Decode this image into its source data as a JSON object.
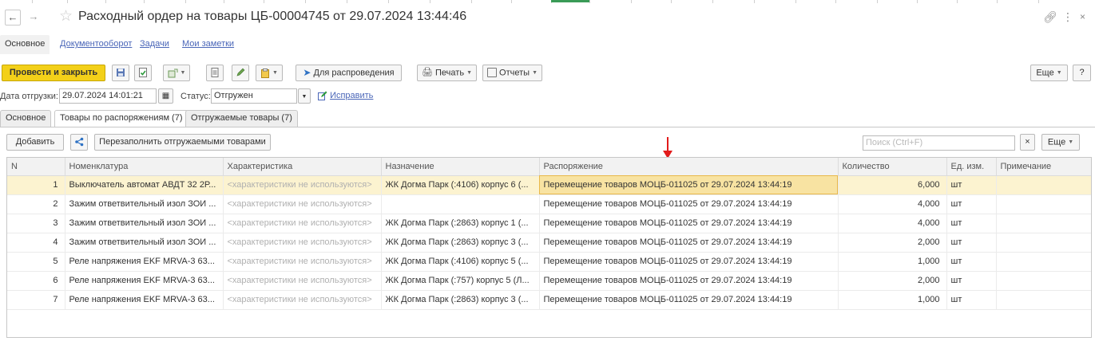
{
  "window": {
    "title": "Расходный ордер на товары ЦБ-00004745 от 29.07.2024 13:44:46"
  },
  "link_tabs": [
    "Основное",
    "Документооборот",
    "Задачи",
    "Мои заметки"
  ],
  "toolbar": {
    "post_close": "Провести и закрыть",
    "for_distribution": "Для распроведения",
    "print": "Печать",
    "reports": "Отчеты",
    "more": "Еще",
    "help": "?"
  },
  "header": {
    "ship_date_label": "Дата отгрузки:",
    "ship_date_value": "29.07.2024 14:01:21",
    "status_label": "Статус:",
    "status_value": "Отгружен",
    "fix_link": "Исправить"
  },
  "tabs": [
    "Основное",
    "Товары по распоряжениям (7)",
    "Отгружаемые товары (7)"
  ],
  "table_toolbar": {
    "add": "Добавить",
    "refill": "Перезаполнить отгружаемыми товарами",
    "search_placeholder": "Поиск (Ctrl+F)",
    "clear": "×",
    "more": "Еще"
  },
  "table": {
    "columns": [
      "N",
      "Номенклатура",
      "Характеристика",
      "Назначение",
      "Распоряжение",
      "Количество",
      "Ед. изм.",
      "Примечание"
    ],
    "rows": [
      {
        "n": "1",
        "item": "Выключатель автомат АВДТ 32 2Р...",
        "char": "<характеристики не используются>",
        "dest": "ЖК Догма Парк (:4106) корпус 6 (...",
        "order": "Перемещение товаров МОЦБ-011025 от 29.07.2024 13:44:19",
        "qty": "6,000",
        "unit": "шт",
        "note": ""
      },
      {
        "n": "2",
        "item": "Зажим ответвительный изол ЗОИ ...",
        "char": "<характеристики не используются>",
        "dest": "",
        "order": "Перемещение товаров МОЦБ-011025 от 29.07.2024 13:44:19",
        "qty": "4,000",
        "unit": "шт",
        "note": ""
      },
      {
        "n": "3",
        "item": "Зажим ответвительный изол ЗОИ ...",
        "char": "<характеристики не используются>",
        "dest": "ЖК Догма Парк (:2863) корпус 1 (...",
        "order": "Перемещение товаров МОЦБ-011025 от 29.07.2024 13:44:19",
        "qty": "4,000",
        "unit": "шт",
        "note": ""
      },
      {
        "n": "4",
        "item": "Зажим ответвительный изол ЗОИ ...",
        "char": "<характеристики не используются>",
        "dest": "ЖК Догма Парк (:2863) корпус 3 (...",
        "order": "Перемещение товаров МОЦБ-011025 от 29.07.2024 13:44:19",
        "qty": "2,000",
        "unit": "шт",
        "note": ""
      },
      {
        "n": "5",
        "item": "Реле напряжения EKF MRVA-3 63...",
        "char": "<характеристики не используются>",
        "dest": "ЖК Догма Парк (:4106) корпус 5 (...",
        "order": "Перемещение товаров МОЦБ-011025 от 29.07.2024 13:44:19",
        "qty": "1,000",
        "unit": "шт",
        "note": ""
      },
      {
        "n": "6",
        "item": "Реле напряжения EKF MRVA-3 63...",
        "char": "<характеристики не используются>",
        "dest": "ЖК Догма Парк (:757) корпус 5 (Л...",
        "order": "Перемещение товаров МОЦБ-011025 от 29.07.2024 13:44:19",
        "qty": "2,000",
        "unit": "шт",
        "note": ""
      },
      {
        "n": "7",
        "item": "Реле напряжения EKF MRVA-3 63...",
        "char": "<характеристики не используются>",
        "dest": "ЖК Догма Парк (:2863) корпус 3 (...",
        "order": "Перемещение товаров МОЦБ-011025 от 29.07.2024 13:44:19",
        "qty": "1,000",
        "unit": "шт",
        "note": ""
      }
    ]
  },
  "colors": {
    "primary_button": "#f3d019",
    "link": "#4a66b8",
    "selected_row": "#fcf3d0",
    "annotation_arrow": "#e21b1b"
  }
}
